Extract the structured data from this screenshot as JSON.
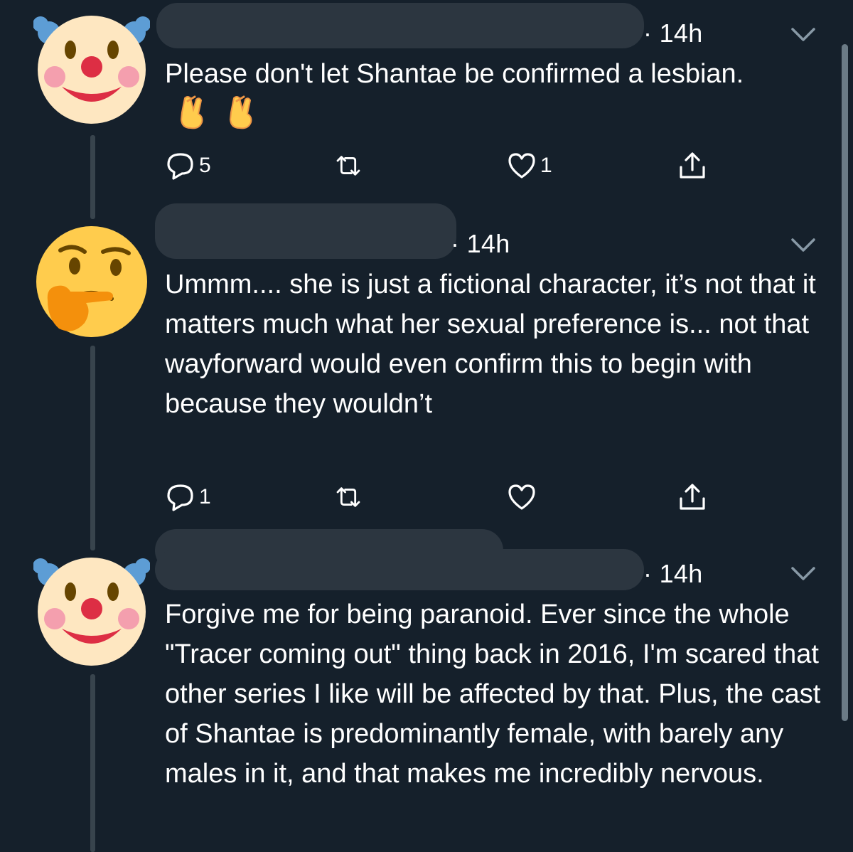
{
  "tweets": [
    {
      "avatar": "clown-face-emoji",
      "time": "· 14h",
      "text": "Please don't let Shantae be confirmed a lesbian.",
      "trailing_emoji": [
        "crossed-fingers-emoji",
        "crossed-fingers-emoji"
      ],
      "reply_count": "5",
      "retweet_count": "",
      "like_count": "1"
    },
    {
      "avatar": "thinking-face-emoji",
      "time": "· 14h",
      "text": "Ummm.... she is just a fictional character, it’s not that it matters much what her sexual preference is... not that wayforward would even confirm this to begin with because they wouldn’t",
      "reply_count": "1",
      "retweet_count": "",
      "like_count": ""
    },
    {
      "avatar": "clown-face-emoji",
      "time": "· 14h",
      "text": "Forgive me for being paranoid. Ever since the whole \"Tracer coming out\" thing back in 2016, I'm scared that other series I like will be affected by that. Plus, the cast of Shantae is predominantly female, with barely any males in it, and that makes me incredibly nervous."
    }
  ],
  "colors": {
    "background": "#15202b",
    "thread_line": "#38444d",
    "redaction": "#2c3640",
    "text": "#ffffff"
  }
}
